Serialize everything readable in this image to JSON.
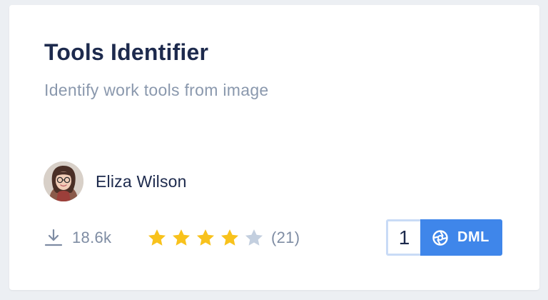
{
  "card": {
    "title": "Tools Identifier",
    "subtitle": "Identify work tools from image"
  },
  "author": {
    "name": "Eliza Wilson",
    "avatar_icon": "avatar-photo"
  },
  "stats": {
    "downloads_icon": "download-icon",
    "downloads": "18.6k",
    "rating_value": 4,
    "rating_max": 5,
    "rating_count": "(21)"
  },
  "badge": {
    "count": "1",
    "label": "DML",
    "icon": "dml-aperture-icon"
  },
  "colors": {
    "title": "#1d2a4d",
    "muted": "#7e8ca3",
    "star_filled": "#f8c21c",
    "star_empty": "#c3cfdf",
    "accent": "#3f86ea",
    "page_background": "#eceff3"
  }
}
